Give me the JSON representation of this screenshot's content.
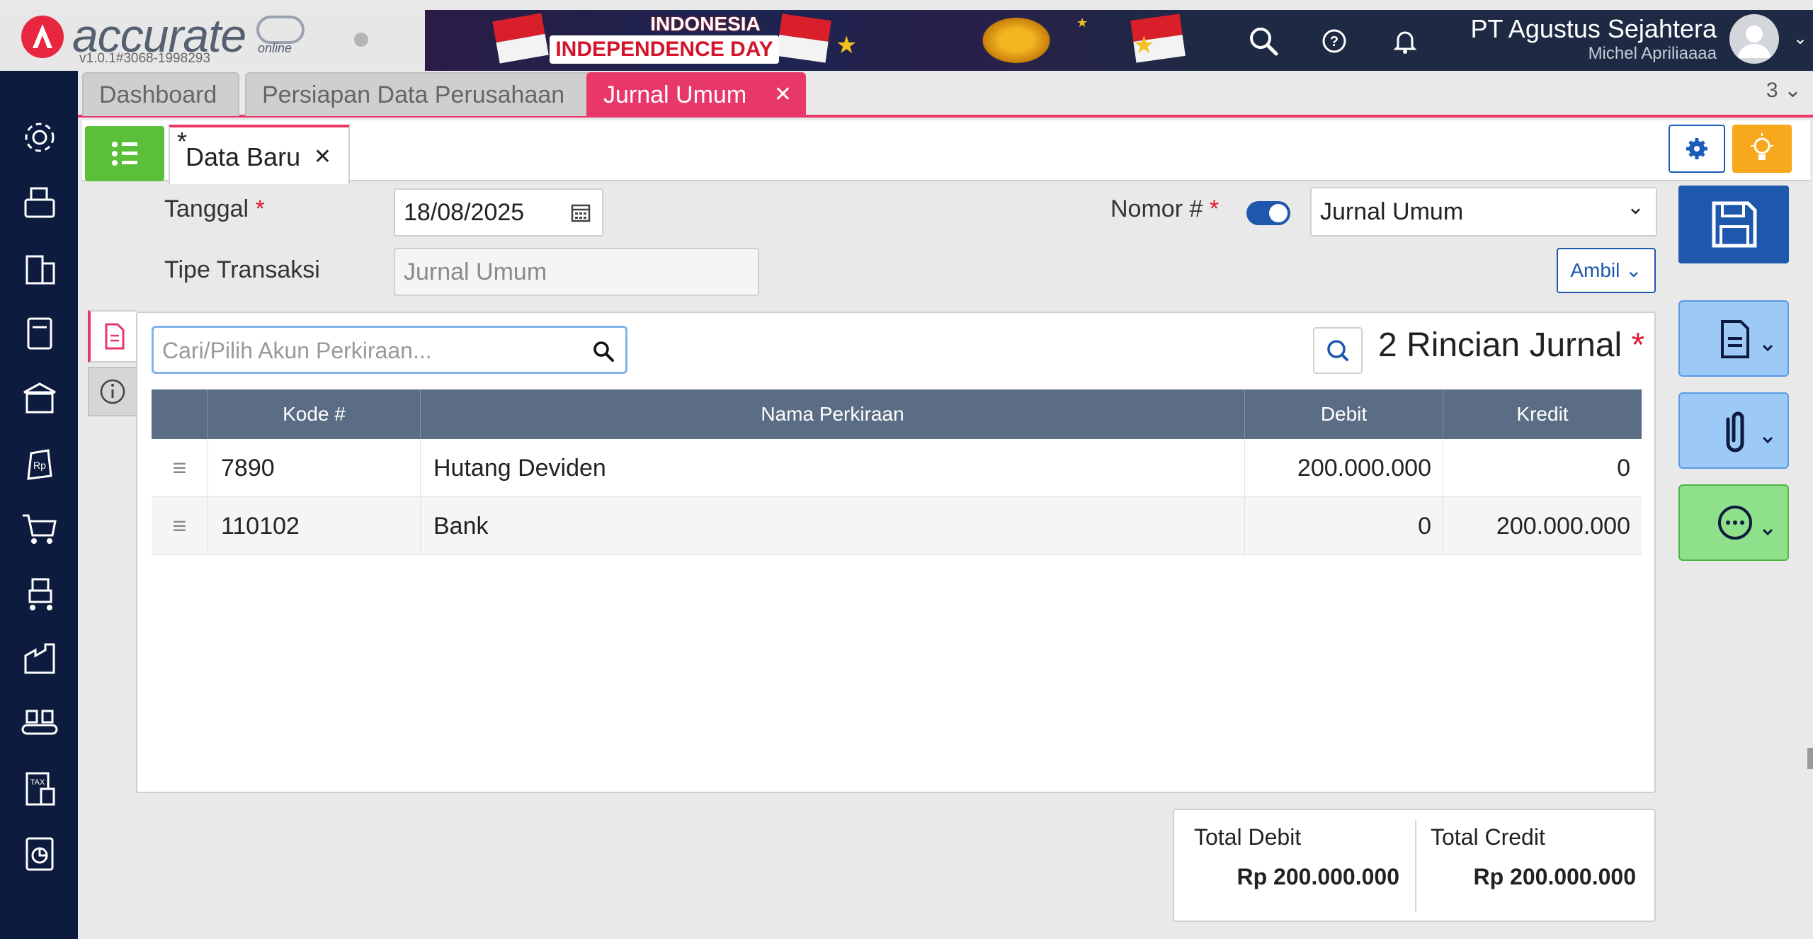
{
  "header": {
    "logo_text": "accurate",
    "logo_sub": "online",
    "version": "v1.0.1#3068-1998293",
    "banner_line1": "INDONESIA",
    "banner_line2": "INDEPENDENCE DAY",
    "company": "PT Agustus Sejahtera",
    "user": "Michel Apriliaaaa"
  },
  "sidebar": {
    "icons": [
      "gear-icon",
      "fax-icon",
      "building-icon",
      "book-icon",
      "bank-icon",
      "money-bag-icon",
      "cart-icon",
      "trolley-icon",
      "factory-icon",
      "conveyor-icon",
      "tax-icon",
      "report-icon"
    ]
  },
  "tabs": [
    {
      "label": "Dashboard"
    },
    {
      "label": "Persiapan Data Perusahaan"
    },
    {
      "label": "Jurnal Umum",
      "close": "✕"
    }
  ],
  "tab_count": "3",
  "subtab": {
    "label": "Data Baru",
    "modified_mark": "*",
    "close": "✕"
  },
  "form": {
    "tanggal_label": "Tanggal",
    "tanggal_value": "18/08/2025",
    "nomor_label": "Nomor #",
    "nomor_value": "Jurnal Umum",
    "tipe_label": "Tipe Transaksi",
    "tipe_placeholder": "Jurnal Umum",
    "ambil_label": "Ambil",
    "required_mark": "*"
  },
  "detail": {
    "search_placeholder": "Cari/Pilih Akun Perkiraan...",
    "count_title": "2 Rincian Jurnal",
    "columns": [
      "Kode #",
      "Nama Perkiraan",
      "Debit",
      "Kredit"
    ],
    "rows": [
      {
        "kode": "7890",
        "nama": "Hutang Deviden",
        "debit": "200.000.000",
        "kredit": "0"
      },
      {
        "kode": "110102",
        "nama": "Bank",
        "debit": "0",
        "kredit": "200.000.000"
      }
    ]
  },
  "totals": {
    "debit_label": "Total Debit",
    "debit_value": "Rp 200.000.000",
    "credit_label": "Total Credit",
    "credit_value": "Rp 200.000.000"
  },
  "colors": {
    "accent": "#e8386a",
    "sidebar": "#0d1b3e",
    "primary": "#1d58ad",
    "grid_header": "#5a6d85"
  }
}
